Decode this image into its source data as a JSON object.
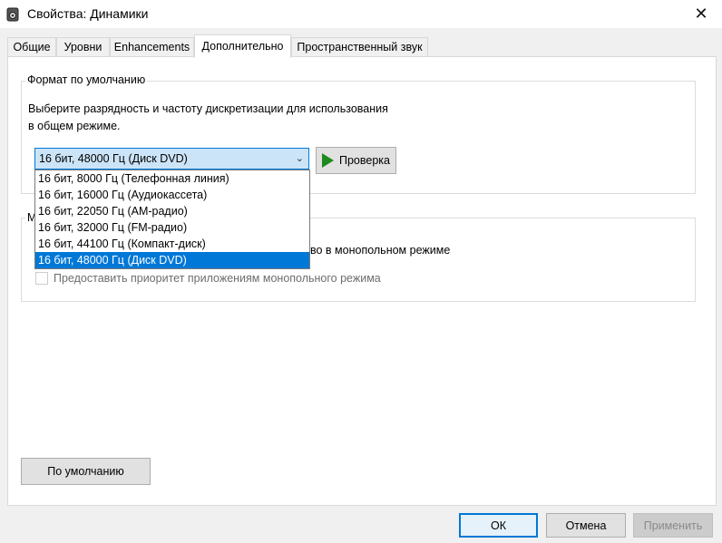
{
  "window": {
    "title": "Свойства: Динамики",
    "close_glyph": "✕",
    "icon": "speaker-icon"
  },
  "tabs": [
    {
      "label": "Общие"
    },
    {
      "label": "Уровни"
    },
    {
      "label": "Enhancements"
    },
    {
      "label": "Дополнительно",
      "active": true
    },
    {
      "label": "Пространственный звук"
    }
  ],
  "default_format": {
    "legend": "Формат по умолчанию",
    "description_line1": "Выберите разрядность и частоту дискретизации для использования",
    "description_line2": "в общем режиме.",
    "selected_value": "16 бит, 48000 Гц (Диск DVD)",
    "options": [
      "16 бит, 8000 Гц (Телефонная линия)",
      "16 бит, 16000 Гц (Аудиокассета)",
      "16 бит, 22050 Гц (AM-радио)",
      "16 бит, 32000 Гц (FM-радио)",
      "16 бит, 44100 Гц (Компакт-диск)",
      "16 бит, 48000 Гц (Диск DVD)"
    ],
    "test_button": "Проверка"
  },
  "exclusive_mode": {
    "legend_visible": "М",
    "option1_visible_tail": "во в монопольном режиме",
    "option2": "Предоставить приоритет приложениям монопольного режима"
  },
  "footer": {
    "restore_defaults": "По умолчанию",
    "ok": "ОК",
    "cancel": "Отмена",
    "apply": "Применить"
  },
  "colors": {
    "accent": "#0078d7",
    "play_green": "#1e8a1e"
  }
}
